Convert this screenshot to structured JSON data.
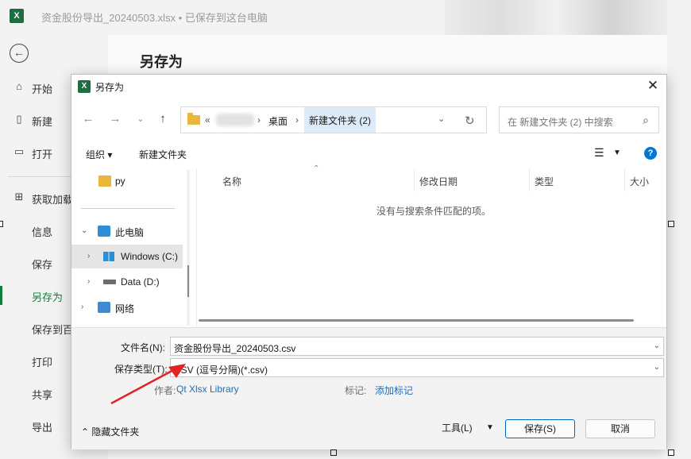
{
  "app": {
    "title": "资金股份导出_20240503.xlsx • 已保存到这台电脑",
    "logo_letter": "X",
    "back_icon": "back-arrow-icon",
    "backstage_heading": "另存为"
  },
  "leftnav": {
    "items": [
      {
        "label": "开始",
        "icon": "home-icon"
      },
      {
        "label": "新建",
        "icon": "new-file-icon"
      },
      {
        "label": "打开",
        "icon": "open-folder-icon"
      },
      {
        "label": "获取加载",
        "icon": "addins-icon"
      },
      {
        "label": "信息"
      },
      {
        "label": "保存"
      },
      {
        "label": "另存为",
        "active": true
      },
      {
        "label": "保存到百"
      },
      {
        "label": "打印"
      },
      {
        "label": "共享"
      },
      {
        "label": "导出"
      }
    ]
  },
  "dialog": {
    "title": "另存为",
    "close": "✕",
    "address": {
      "prefix": "«",
      "crumbs": [
        "桌面",
        "新建文件夹 (2)"
      ]
    },
    "search_placeholder": "在 新建文件夹 (2) 中搜索",
    "toolbar": {
      "organize": "组织 ▾",
      "new_folder": "新建文件夹",
      "help": "?"
    },
    "tree": [
      {
        "label": "py",
        "icon": "folder-icon"
      },
      {
        "label": "此电脑",
        "icon": "pc-icon"
      },
      {
        "label": "Windows (C:)",
        "icon": "windows-drive-icon"
      },
      {
        "label": "Data (D:)",
        "icon": "drive-icon"
      },
      {
        "label": "网络",
        "icon": "network-icon"
      }
    ],
    "columns": [
      "名称",
      "修改日期",
      "类型",
      "大小"
    ],
    "empty_message": "没有与搜索条件匹配的项。",
    "filename_label": "文件名(N):",
    "filename_value": "资金股份导出_20240503.csv",
    "filetype_label": "保存类型(T):",
    "filetype_value": "CSV (逗号分隔)(*.csv)",
    "author_label": "作者:",
    "author_value": "Qt Xlsx Library",
    "tags_label": "标记:",
    "tags_value": "添加标记",
    "hide_folders": "隐藏文件夹",
    "tools": "工具(L)",
    "save": "保存(S)",
    "cancel": "取消"
  },
  "colors": {
    "excel_green": "#107c41",
    "accent_blue": "#0067c0",
    "link_blue": "#1f6fb5",
    "annotation_red": "#e02424"
  }
}
